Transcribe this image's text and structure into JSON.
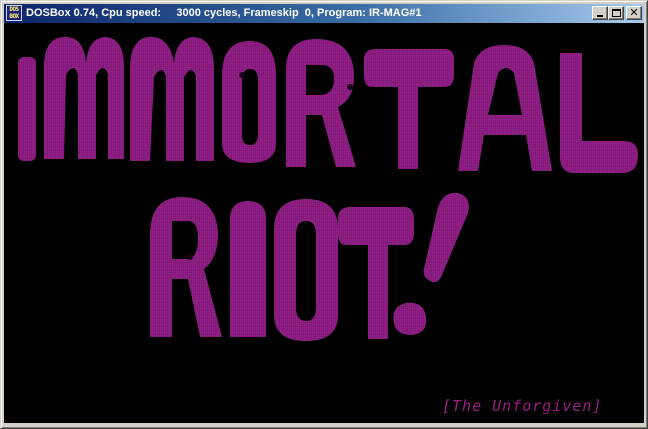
{
  "window": {
    "title": "DOSBox 0.74, Cpu speed:     3000 cycles, Frameskip  0, Program: IR-MAG#1",
    "icon": {
      "name": "dosbox-icon",
      "line1": "DOS",
      "line2": "BOX"
    },
    "controls": {
      "minimize_icon": "minimize-icon",
      "maximize_icon": "maximize-icon",
      "close_icon": "close-icon",
      "close_glyph": "✕"
    }
  },
  "screen": {
    "logo": {
      "line1_letters": [
        "I",
        "M",
        "M",
        "O",
        "R",
        "T",
        "A",
        "L"
      ],
      "line2_letters": [
        "R",
        "I",
        "O",
        "T",
        "!"
      ],
      "colors": {
        "fill": "#8a1a80",
        "highlight": "#b02aa2",
        "shadow": "#4a0a46"
      }
    },
    "credit": "[The Unforgiven]",
    "background": "#000000"
  }
}
